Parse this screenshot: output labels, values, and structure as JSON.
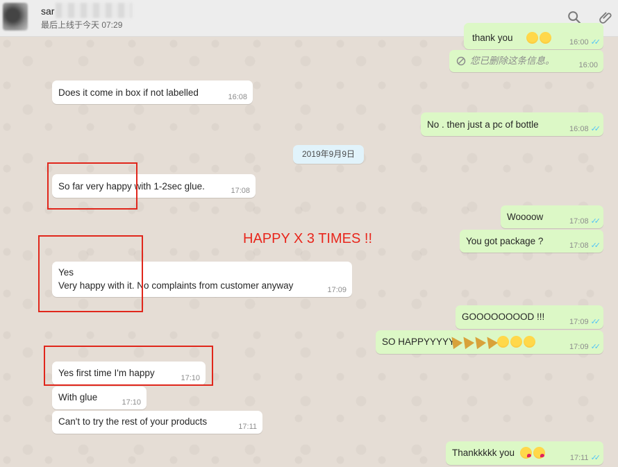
{
  "header": {
    "contact_name": "sar",
    "last_seen": "最后上线于今天 07:29"
  },
  "date_chip": "2019年9月9日",
  "annotation": "HAPPY X 3 TIMES !!",
  "messages": {
    "m0": {
      "text": "thank you",
      "time": "16:00"
    },
    "m1": {
      "text": "您已删除这条信息。",
      "time": "16:00"
    },
    "m2": {
      "text": "Does it come in box if not labelled",
      "time": "16:08"
    },
    "m3": {
      "text": "No . then just a pc of bottle",
      "time": "16:08"
    },
    "m4": {
      "text": "So far very happy with 1-2sec glue.",
      "time": "17:08"
    },
    "m5": {
      "text": "Woooow",
      "time": "17:08"
    },
    "m6": {
      "text": "You got package ?",
      "time": "17:08"
    },
    "m7": {
      "line1": "Yes",
      "line2": "Very happy with it. No complaints from customer anyway",
      "time": "17:09"
    },
    "m8": {
      "text": "GOOOOOOOOD !!!",
      "time": "17:09"
    },
    "m9": {
      "text": "SO HAPPYYYYY",
      "time": "17:09"
    },
    "m10": {
      "text": "Yes first time I'm happy",
      "time": "17:10"
    },
    "m11": {
      "text": "With glue",
      "time": "17:10"
    },
    "m12": {
      "text": "Can't to try the rest of your products",
      "time": "17:11"
    },
    "m13": {
      "text": "Thankkkkk you",
      "time": "17:11"
    }
  },
  "icons": {
    "search": "search-icon",
    "attach": "paperclip-icon"
  },
  "colors": {
    "incoming": "#ffffff",
    "outgoing": "#dcf8c6",
    "read_ticks": "#4fc3f7",
    "annotation": "#e8261c"
  }
}
